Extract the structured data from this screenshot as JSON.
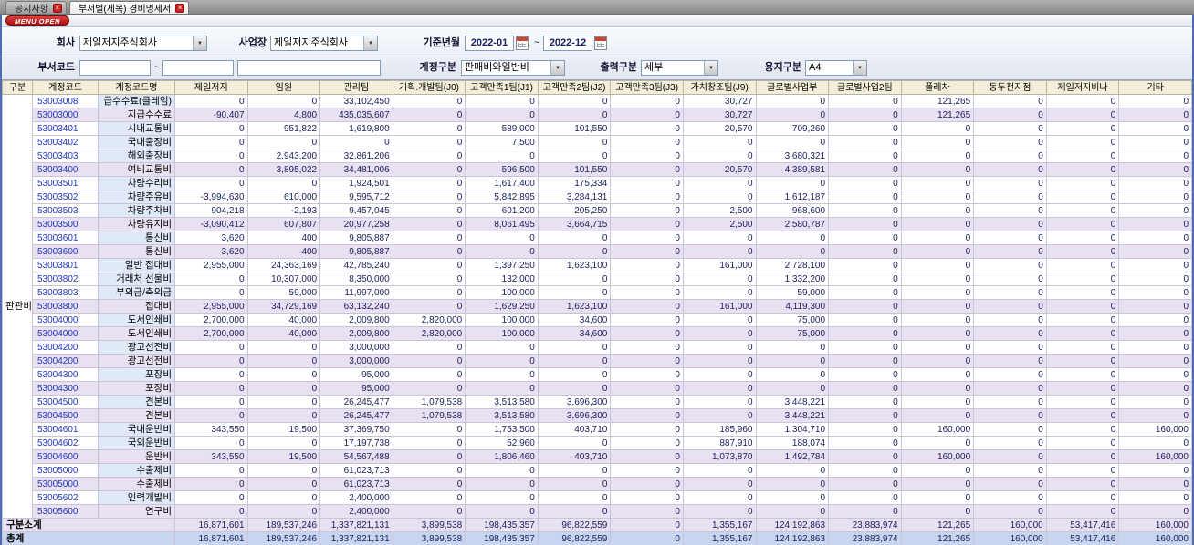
{
  "tabs": [
    {
      "label": "공지사항",
      "active": false
    },
    {
      "label": "부서별(세목) 경비명세서",
      "active": true
    }
  ],
  "menu_button": "MENU OPEN",
  "filters": {
    "company_label": "회사",
    "company_value": "제일저지주식회사",
    "site_label": "사업장",
    "site_value": "제일저지주식회사",
    "period_label": "기준년월",
    "period_from": "2022-01",
    "period_to": "2022-12",
    "tilde": "~",
    "dept_label": "부서코드",
    "dept_from": "",
    "dept_to": "",
    "dept_name": "",
    "account_label": "계정구분",
    "account_value": "판매비와일반비",
    "output_label": "출력구분",
    "output_value": "세부",
    "paper_label": "용지구분",
    "paper_value": "A4"
  },
  "icons": {
    "calendar": "calendar-icon",
    "dropdown_arrow": "▼",
    "close": "×"
  },
  "table": {
    "columns": [
      "구분",
      "계정코드",
      "계정코드명",
      "제일저지",
      "임원",
      "관리팀",
      "기획.개발팀(J0)",
      "고객만족1팀(J1)",
      "고객만족2팀(J2)",
      "고객만족3팀(J3)",
      "가치창조팀(J9)",
      "글로벌사업부",
      "글로벌사업2팀",
      "플레차",
      "동두천지점",
      "제일저지비나",
      "기타"
    ],
    "group_label": "판관비",
    "rows": [
      {
        "code": "53003008",
        "name": "급수수료(클레임)",
        "type": "detail",
        "values": [
          "0",
          "0",
          "33,102,450",
          "0",
          "0",
          "0",
          "0",
          "30,727",
          "0",
          "0",
          "121,265",
          "0",
          "0",
          "0"
        ]
      },
      {
        "code": "53003000",
        "name": "지급수수료",
        "type": "total",
        "values": [
          "-90,407",
          "4,800",
          "435,035,607",
          "0",
          "0",
          "0",
          "0",
          "30,727",
          "0",
          "0",
          "121,265",
          "0",
          "0",
          "0"
        ]
      },
      {
        "code": "53003401",
        "name": "시내교통비",
        "type": "detail",
        "values": [
          "0",
          "951,822",
          "1,619,800",
          "0",
          "589,000",
          "101,550",
          "0",
          "20,570",
          "709,260",
          "0",
          "0",
          "0",
          "0",
          "0"
        ]
      },
      {
        "code": "53003402",
        "name": "국내출장비",
        "type": "detail",
        "values": [
          "0",
          "0",
          "0",
          "0",
          "7,500",
          "0",
          "0",
          "0",
          "0",
          "0",
          "0",
          "0",
          "0",
          "0"
        ]
      },
      {
        "code": "53003403",
        "name": "해외출장비",
        "type": "detail",
        "values": [
          "0",
          "2,943,200",
          "32,861,206",
          "0",
          "0",
          "0",
          "0",
          "0",
          "3,680,321",
          "0",
          "0",
          "0",
          "0",
          "0"
        ]
      },
      {
        "code": "53003400",
        "name": "여비교통비",
        "type": "total",
        "values": [
          "0",
          "3,895,022",
          "34,481,006",
          "0",
          "596,500",
          "101,550",
          "0",
          "20,570",
          "4,389,581",
          "0",
          "0",
          "0",
          "0",
          "0"
        ]
      },
      {
        "code": "53003501",
        "name": "차량수리비",
        "type": "detail",
        "values": [
          "0",
          "0",
          "1,924,501",
          "0",
          "1,617,400",
          "175,334",
          "0",
          "0",
          "0",
          "0",
          "0",
          "0",
          "0",
          "0"
        ]
      },
      {
        "code": "53003502",
        "name": "차량주유비",
        "type": "detail",
        "values": [
          "-3,994,630",
          "610,000",
          "9,595,712",
          "0",
          "5,842,895",
          "3,284,131",
          "0",
          "0",
          "1,612,187",
          "0",
          "0",
          "0",
          "0",
          "0"
        ]
      },
      {
        "code": "53003503",
        "name": "차량주차비",
        "type": "detail",
        "values": [
          "904,218",
          "-2,193",
          "9,457,045",
          "0",
          "601,200",
          "205,250",
          "0",
          "2,500",
          "968,600",
          "0",
          "0",
          "0",
          "0",
          "0"
        ]
      },
      {
        "code": "53003500",
        "name": "차량유지비",
        "type": "total",
        "values": [
          "-3,090,412",
          "607,807",
          "20,977,258",
          "0",
          "8,061,495",
          "3,664,715",
          "0",
          "2,500",
          "2,580,787",
          "0",
          "0",
          "0",
          "0",
          "0"
        ]
      },
      {
        "code": "53003601",
        "name": "통신비",
        "type": "detail",
        "values": [
          "3,620",
          "400",
          "9,805,887",
          "0",
          "0",
          "0",
          "0",
          "0",
          "0",
          "0",
          "0",
          "0",
          "0",
          "0"
        ]
      },
      {
        "code": "53003600",
        "name": "통신비",
        "type": "total",
        "values": [
          "3,620",
          "400",
          "9,805,887",
          "0",
          "0",
          "0",
          "0",
          "0",
          "0",
          "0",
          "0",
          "0",
          "0",
          "0"
        ]
      },
      {
        "code": "53003801",
        "name": "일반 접대비",
        "type": "detail",
        "values": [
          "2,955,000",
          "24,363,169",
          "42,785,240",
          "0",
          "1,397,250",
          "1,623,100",
          "0",
          "161,000",
          "2,728,100",
          "0",
          "0",
          "0",
          "0",
          "0"
        ]
      },
      {
        "code": "53003802",
        "name": "거래처 선물비",
        "type": "detail",
        "values": [
          "0",
          "10,307,000",
          "8,350,000",
          "0",
          "132,000",
          "0",
          "0",
          "0",
          "1,332,200",
          "0",
          "0",
          "0",
          "0",
          "0"
        ]
      },
      {
        "code": "53003803",
        "name": "부의금/축의금",
        "type": "detail",
        "values": [
          "0",
          "59,000",
          "11,997,000",
          "0",
          "100,000",
          "0",
          "0",
          "0",
          "59,000",
          "0",
          "0",
          "0",
          "0",
          "0"
        ]
      },
      {
        "code": "53003800",
        "name": "접대비",
        "type": "total",
        "values": [
          "2,955,000",
          "34,729,169",
          "63,132,240",
          "0",
          "1,629,250",
          "1,623,100",
          "0",
          "161,000",
          "4,119,300",
          "0",
          "0",
          "0",
          "0",
          "0"
        ]
      },
      {
        "code": "53004000",
        "name": "도서인쇄비",
        "type": "detail",
        "values": [
          "2,700,000",
          "40,000",
          "2,009,800",
          "2,820,000",
          "100,000",
          "34,600",
          "0",
          "0",
          "75,000",
          "0",
          "0",
          "0",
          "0",
          "0"
        ]
      },
      {
        "code": "53004000",
        "name": "도서인쇄비",
        "type": "total",
        "values": [
          "2,700,000",
          "40,000",
          "2,009,800",
          "2,820,000",
          "100,000",
          "34,600",
          "0",
          "0",
          "75,000",
          "0",
          "0",
          "0",
          "0",
          "0"
        ]
      },
      {
        "code": "53004200",
        "name": "광고선전비",
        "type": "detail",
        "values": [
          "0",
          "0",
          "3,000,000",
          "0",
          "0",
          "0",
          "0",
          "0",
          "0",
          "0",
          "0",
          "0",
          "0",
          "0"
        ]
      },
      {
        "code": "53004200",
        "name": "광고선전비",
        "type": "total",
        "values": [
          "0",
          "0",
          "3,000,000",
          "0",
          "0",
          "0",
          "0",
          "0",
          "0",
          "0",
          "0",
          "0",
          "0",
          "0"
        ]
      },
      {
        "code": "53004300",
        "name": "포장비",
        "type": "detail",
        "values": [
          "0",
          "0",
          "95,000",
          "0",
          "0",
          "0",
          "0",
          "0",
          "0",
          "0",
          "0",
          "0",
          "0",
          "0"
        ]
      },
      {
        "code": "53004300",
        "name": "포장비",
        "type": "total",
        "values": [
          "0",
          "0",
          "95,000",
          "0",
          "0",
          "0",
          "0",
          "0",
          "0",
          "0",
          "0",
          "0",
          "0",
          "0"
        ]
      },
      {
        "code": "53004500",
        "name": "견본비",
        "type": "detail",
        "values": [
          "0",
          "0",
          "26,245,477",
          "1,079,538",
          "3,513,580",
          "3,696,300",
          "0",
          "0",
          "3,448,221",
          "0",
          "0",
          "0",
          "0",
          "0"
        ]
      },
      {
        "code": "53004500",
        "name": "견본비",
        "type": "total",
        "values": [
          "0",
          "0",
          "26,245,477",
          "1,079,538",
          "3,513,580",
          "3,696,300",
          "0",
          "0",
          "3,448,221",
          "0",
          "0",
          "0",
          "0",
          "0"
        ]
      },
      {
        "code": "53004601",
        "name": "국내운반비",
        "type": "detail",
        "values": [
          "343,550",
          "19,500",
          "37,369,750",
          "0",
          "1,753,500",
          "403,710",
          "0",
          "185,960",
          "1,304,710",
          "0",
          "160,000",
          "0",
          "0",
          "160,000"
        ]
      },
      {
        "code": "53004602",
        "name": "국외운반비",
        "type": "detail",
        "values": [
          "0",
          "0",
          "17,197,738",
          "0",
          "52,960",
          "0",
          "0",
          "887,910",
          "188,074",
          "0",
          "0",
          "0",
          "0",
          "0"
        ]
      },
      {
        "code": "53004600",
        "name": "운반비",
        "type": "total",
        "values": [
          "343,550",
          "19,500",
          "54,567,488",
          "0",
          "1,806,460",
          "403,710",
          "0",
          "1,073,870",
          "1,492,784",
          "0",
          "160,000",
          "0",
          "0",
          "160,000"
        ]
      },
      {
        "code": "53005000",
        "name": "수출제비",
        "type": "detail",
        "values": [
          "0",
          "0",
          "61,023,713",
          "0",
          "0",
          "0",
          "0",
          "0",
          "0",
          "0",
          "0",
          "0",
          "0",
          "0"
        ]
      },
      {
        "code": "53005000",
        "name": "수출제비",
        "type": "total",
        "values": [
          "0",
          "0",
          "61,023,713",
          "0",
          "0",
          "0",
          "0",
          "0",
          "0",
          "0",
          "0",
          "0",
          "0",
          "0"
        ]
      },
      {
        "code": "53005602",
        "name": "인력개발비",
        "type": "detail",
        "values": [
          "0",
          "0",
          "2,400,000",
          "0",
          "0",
          "0",
          "0",
          "0",
          "0",
          "0",
          "0",
          "0",
          "0",
          "0"
        ]
      },
      {
        "code": "53005600",
        "name": "연구비",
        "type": "total",
        "values": [
          "0",
          "0",
          "2,400,000",
          "0",
          "0",
          "0",
          "0",
          "0",
          "0",
          "0",
          "0",
          "0",
          "0",
          "0"
        ]
      }
    ],
    "subtotal": {
      "label": "구분소계",
      "values": [
        "16,871,601",
        "189,537,246",
        "1,337,821,131",
        "3,899,538",
        "198,435,357",
        "96,822,559",
        "0",
        "1,355,167",
        "124,192,863",
        "23,883,974",
        "121,265",
        "160,000",
        "53,417,416",
        "160,000"
      ]
    },
    "total": {
      "label": "총계",
      "values": [
        "16,871,601",
        "189,537,246",
        "1,337,821,131",
        "3,899,538",
        "198,435,357",
        "96,822,559",
        "0",
        "1,355,167",
        "124,192,863",
        "23,883,974",
        "121,265",
        "160,000",
        "53,417,416",
        "160,000"
      ]
    }
  }
}
